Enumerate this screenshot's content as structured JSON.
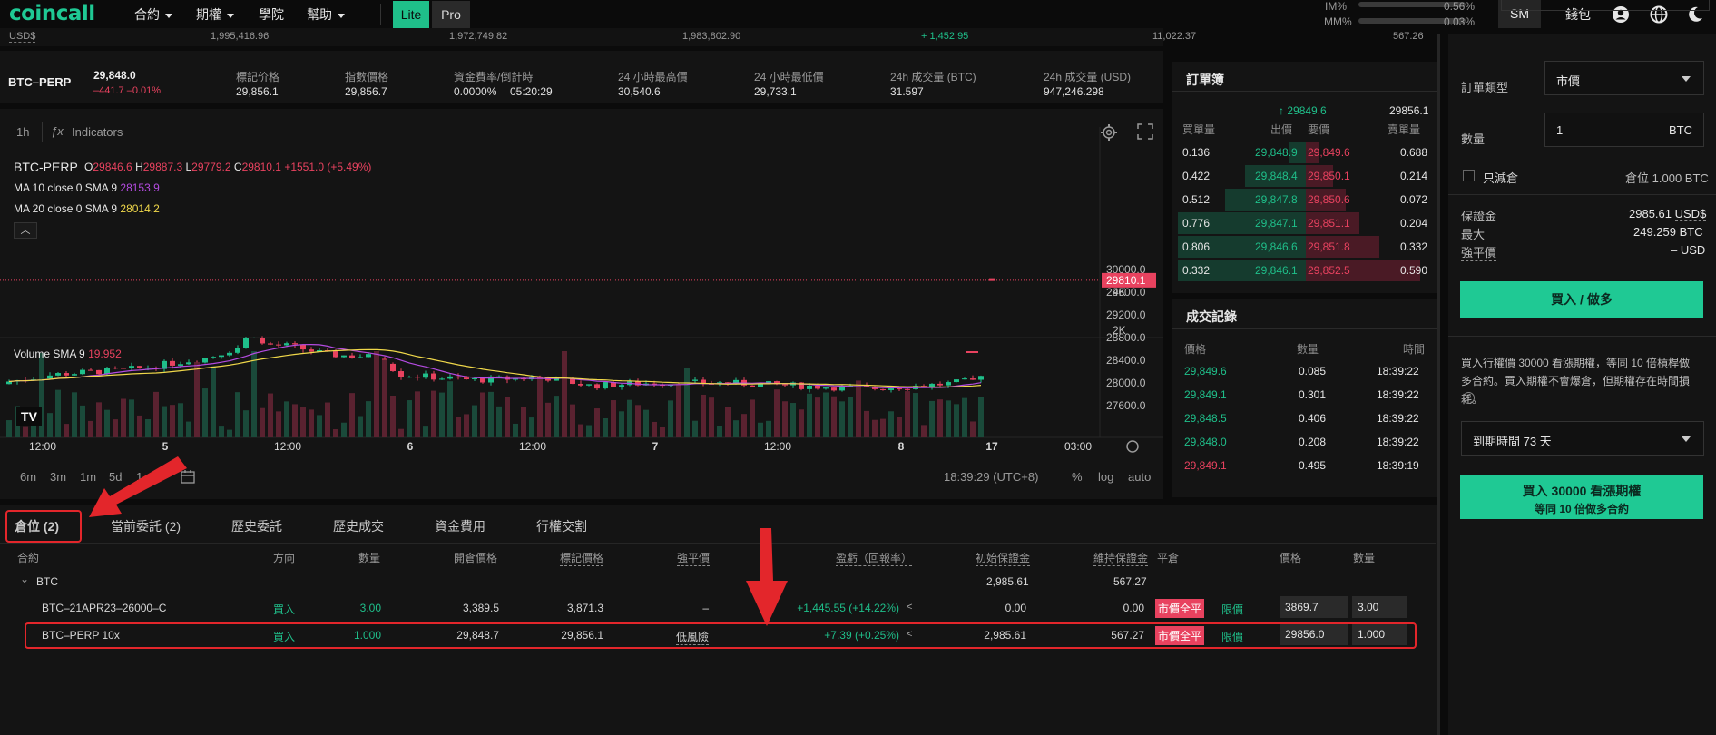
{
  "nav": {
    "logo": "coincall",
    "items": [
      "合約",
      "期權",
      "學院",
      "幫助"
    ],
    "lite": "Lite",
    "pro": "Pro",
    "im_label": "IM%",
    "im_value": "0.56%",
    "mm_label": "MM%",
    "mm_value": "0.03%",
    "sm": "SM",
    "wallet": "錢包"
  },
  "stats_strip": [
    "USD$",
    "1,995,416.96",
    "1,972,749.82",
    "1,983,802.90",
    "+ 1,452.95",
    "11,022.37",
    "567.26"
  ],
  "ticker": {
    "symbol": "BTC–PERP",
    "price": "29,848.0",
    "change": "–441.7 –0.01%",
    "fields": [
      {
        "label": "標記价格",
        "value": "29,856.1"
      },
      {
        "label": "指數價格",
        "value": "29,856.7"
      },
      {
        "label": "資金費率/倒計時",
        "value": "0.0000%",
        "value2": "05:20:29"
      },
      {
        "label": "24 小時最高價",
        "value": "30,540.6"
      },
      {
        "label": "24 小時最低價",
        "value": "29,733.1"
      },
      {
        "label": "24h 成交量 (BTC)",
        "value": "31.597"
      },
      {
        "label": "24h 成交量 (USD)",
        "value": "947,246.298"
      }
    ]
  },
  "chart": {
    "interval": "1h",
    "indicators": "Indicators",
    "legend_symbol": "BTC-PERP",
    "ohlc": {
      "o_label": "O",
      "o": "29846.6",
      "h_label": "H",
      "h": "29887.3",
      "l_label": "L",
      "l": "29779.2",
      "c_label": "C",
      "c": "29810.1",
      "chg": "+1551.0 (+5.49%)"
    },
    "ma10": {
      "label": "MA 10 close 0 SMA 9",
      "value": "28153.9"
    },
    "ma20": {
      "label": "MA 20 close 0 SMA 9",
      "value": "28014.2"
    },
    "volume_label": "Volume SMA 9",
    "volume_value": "19.952",
    "price_axis": [
      "30000.0",
      "29600.0",
      "29200.0",
      "28800.0",
      "28400.0",
      "28000.0",
      "27600.0"
    ],
    "last_price": "29810.1",
    "volume_axis": [
      "4K",
      "2K"
    ],
    "time_axis": [
      "12:00",
      "5",
      "12:00",
      "6",
      "12:00",
      "7",
      "12:00",
      "8",
      "17",
      "03:00"
    ],
    "ranges": [
      "6m",
      "3m",
      "1m",
      "5d",
      "1"
    ],
    "clock": "18:39:29 (UTC+8)",
    "scale_opts": [
      "%",
      "log",
      "auto"
    ]
  },
  "orderbook": {
    "title": "訂單簿",
    "mid_price": "29849.6",
    "mark": "29856.1",
    "headers": [
      "買單量",
      "出價",
      "要價",
      "賣單量"
    ],
    "rows": [
      {
        "bid_qty": "0.136",
        "bid": "29,848.9",
        "ask": "29,849.6",
        "ask_qty": "0.688",
        "bid_depth": 0.12,
        "ask_depth": 0.1
      },
      {
        "bid_qty": "0.422",
        "bid": "29,848.4",
        "ask": "29,850.1",
        "ask_qty": "0.214",
        "bid_depth": 0.45,
        "ask_depth": 0.2
      },
      {
        "bid_qty": "0.512",
        "bid": "29,847.8",
        "ask": "29,850.6",
        "ask_qty": "0.072",
        "bid_depth": 0.6,
        "ask_depth": 0.3
      },
      {
        "bid_qty": "0.776",
        "bid": "29,847.1",
        "ask": "29,851.1",
        "ask_qty": "0.204",
        "bid_depth": 0.95,
        "ask_depth": 0.4
      },
      {
        "bid_qty": "0.806",
        "bid": "29,846.6",
        "ask": "29,851.8",
        "ask_qty": "0.332",
        "bid_depth": 0.95,
        "ask_depth": 0.55
      },
      {
        "bid_qty": "0.332",
        "bid": "29,846.1",
        "ask": "29,852.5",
        "ask_qty": "0.590",
        "bid_depth": 0.95,
        "ask_depth": 0.85
      }
    ]
  },
  "trades": {
    "title": "成交記錄",
    "headers": [
      "價格",
      "數量",
      "時間"
    ],
    "rows": [
      {
        "price": "29,849.6",
        "qty": "0.085",
        "time": "18:39:22",
        "side": "buy"
      },
      {
        "price": "29,849.1",
        "qty": "0.301",
        "time": "18:39:22",
        "side": "buy"
      },
      {
        "price": "29,848.5",
        "qty": "0.406",
        "time": "18:39:22",
        "side": "buy"
      },
      {
        "price": "29,848.0",
        "qty": "0.208",
        "time": "18:39:22",
        "side": "buy"
      },
      {
        "price": "29,849.1",
        "qty": "0.495",
        "time": "18:39:19",
        "side": "sell"
      }
    ]
  },
  "positions": {
    "tabs": [
      "倉位 (2)",
      "當前委託 (2)",
      "歷史委託",
      "歷史成交",
      "資金費用",
      "行權交割"
    ],
    "headers": [
      "合約",
      "方向",
      "數量",
      "開倉價格",
      "標記價格",
      "強平價",
      "盈虧（回報率）",
      "初始保證金",
      "維持保證金",
      "平倉",
      "價格",
      "數量"
    ],
    "group": {
      "name": "BTC",
      "initial_margin": "2,985.61",
      "maint_margin": "567.27"
    },
    "rows": [
      {
        "contract": "BTC–21APR23–26000–C",
        "side": "買入",
        "qty": "3.00",
        "open": "3,389.5",
        "mark": "3,871.3",
        "liq": "–",
        "pnl": "+1,445.55 (+14.22%)",
        "init": "0.00",
        "maint": "0.00",
        "close_market": "市價全平",
        "close_limit": "限價",
        "price_in": "3869.7",
        "qty_in": "3.00"
      },
      {
        "contract": "BTC–PERP 10x",
        "side": "買入",
        "qty": "1.000",
        "open": "29,848.7",
        "mark": "29,856.1",
        "liq": "低風險",
        "pnl": "+7.39 (+0.25%)",
        "init": "2,985.61",
        "maint": "567.27",
        "close_market": "市價全平",
        "close_limit": "限價",
        "price_in": "29856.0",
        "qty_in": "1.000"
      }
    ]
  },
  "orderform": {
    "order_type_label": "訂單類型",
    "order_type": "市價",
    "qty_label": "數量",
    "qty": "1",
    "qty_unit": "BTC",
    "reduce_only": "只減倉",
    "position_label": "倉位",
    "position_value": "1.000 BTC",
    "margin_label": "保證金",
    "margin_value": "2985.61",
    "margin_unit": "USD$",
    "max_label": "最大",
    "max_value": "249.259 BTC",
    "liq_label": "強平價",
    "liq_value": "– USD",
    "buy_button": "買入 / 做多",
    "info": "買入行權價 30000 看漲期權，等同 10 倍槓桿做多合約。買入期權不會爆倉，但期權存在時間損耗。",
    "expiry": "到期時間 73 天",
    "option_buy_title": "買入 30000 看漲期權",
    "option_buy_sub": "等同 10 倍做多合約"
  },
  "colors": {
    "accent": "#1fc994",
    "buy": "#1fbf8a",
    "sell": "#e8425f",
    "annotation": "#e3262b"
  }
}
